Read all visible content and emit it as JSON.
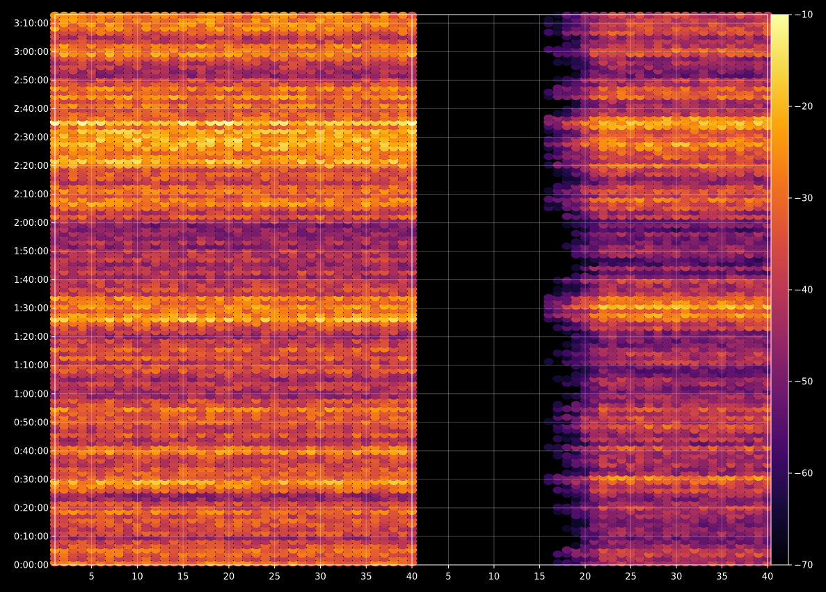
{
  "chart_data": {
    "type": "heatmap",
    "title": "",
    "colormap": "inferno",
    "background": "#000000",
    "panels": [
      {
        "name": "",
        "xlim": [
          1,
          40
        ],
        "xticks": [
          5,
          10,
          15,
          20,
          25,
          30,
          35,
          40
        ],
        "activity_x_range": [
          1,
          40
        ],
        "relative_gain_db": 0
      },
      {
        "name": "",
        "xlim": [
          1,
          40
        ],
        "xticks": [
          5,
          10,
          15,
          20,
          25,
          30,
          35,
          40
        ],
        "activity_x_range": [
          16,
          40
        ],
        "relative_gain_db": -6
      }
    ],
    "y_axis": {
      "unit": "time",
      "min_seconds": 0,
      "max_seconds": 11580,
      "tick_labels": [
        "0:00:00",
        "0:10:00",
        "0:20:00",
        "0:30:00",
        "0:40:00",
        "0:50:00",
        "1:00:00",
        "1:10:00",
        "1:20:00",
        "1:30:00",
        "1:40:00",
        "1:50:00",
        "2:00:00",
        "2:10:00",
        "2:20:00",
        "2:30:00",
        "2:40:00",
        "2:50:00",
        "3:00:00",
        "3:10:00"
      ]
    },
    "colorbar": {
      "vmin": -70,
      "vmax": -10,
      "ticks": [
        -10,
        -20,
        -30,
        -40,
        -50,
        -60,
        -70
      ],
      "tick_labels": [
        "−10",
        "−20",
        "−30",
        "−40",
        "−50",
        "−60",
        "−70"
      ]
    },
    "grid": true,
    "intensity_profile_db": {
      "time_minutes": [
        0,
        6,
        12,
        20,
        24,
        30,
        34,
        40,
        44,
        50,
        56,
        62,
        68,
        74,
        80,
        86,
        90,
        94,
        100,
        106,
        112,
        118,
        124,
        130,
        135,
        140,
        146,
        150,
        156,
        160,
        166,
        172,
        176,
        180,
        184,
        188,
        193
      ],
      "level_db": [
        -30,
        -38,
        -42,
        -32,
        -44,
        -26,
        -38,
        -32,
        -42,
        -30,
        -36,
        -46,
        -40,
        -32,
        -44,
        -28,
        -22,
        -30,
        -40,
        -46,
        -42,
        -50,
        -36,
        -28,
        -40,
        -30,
        -24,
        -26,
        -22,
        -34,
        -30,
        -40,
        -46,
        -30,
        -36,
        -28,
        -32
      ]
    }
  }
}
